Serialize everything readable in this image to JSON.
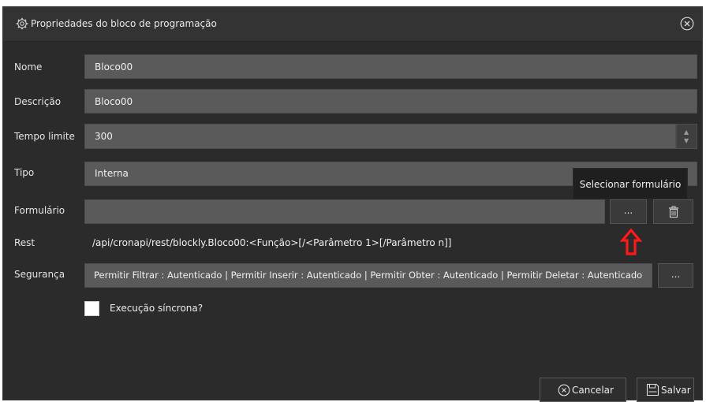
{
  "dialog": {
    "title": "Propriedades do bloco de programação",
    "title_icon": "gear-icon",
    "close_icon": "close-circle-icon"
  },
  "fields": {
    "nome": {
      "label": "Nome",
      "value": "Bloco00"
    },
    "descricao": {
      "label": "Descrição",
      "value": "Bloco00"
    },
    "tempo": {
      "label": "Tempo limite",
      "value": "300"
    },
    "tipo": {
      "label": "Tipo",
      "value": "Interna"
    },
    "formulario": {
      "label": "Formulário",
      "value": "",
      "select_label": "...",
      "delete_icon": "trash-icon"
    },
    "rest": {
      "label": "Rest",
      "value": "/api/cronapi/rest/blockly.Bloco00:<Função>[/<Parâmetro 1>[/Parâmetro n]]"
    },
    "seguranca": {
      "label": "Segurança",
      "value": "Permitir Filtrar : Autenticado | Permitir Inserir : Autenticado | Permitir Obter : Autenticado | Permitir Deletar : Autenticado",
      "button_label": "..."
    }
  },
  "tooltip": {
    "text": "Selecionar formulário"
  },
  "annotation": {
    "icon": "red-up-arrow-icon",
    "color": "#ff0000"
  },
  "checkbox": {
    "label": "Execução síncrona?",
    "checked": false
  },
  "footer": {
    "cancel_label": "Cancelar",
    "cancel_icon": "close-circle-icon",
    "save_label": "Salvar",
    "save_icon": "floppy-icon"
  }
}
